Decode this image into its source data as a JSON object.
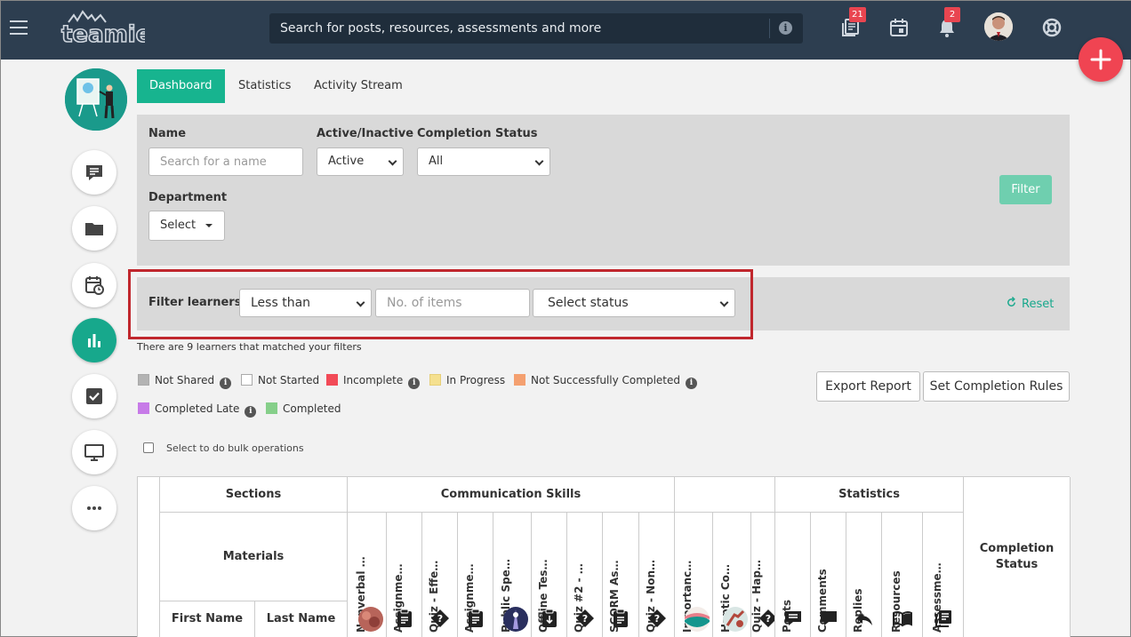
{
  "header": {
    "logo_text": "teamie",
    "search_placeholder": "Search for posts, resources, assessments and more",
    "posts_badge": "21",
    "notifications_badge": "2",
    "icons": [
      "menu-icon",
      "info-icon",
      "posts-feed-icon",
      "calendar-icon",
      "bell-icon",
      "avatar",
      "help-lifebuoy-icon",
      "plus-icon"
    ]
  },
  "tabs": [
    {
      "label": "Dashboard",
      "active": true
    },
    {
      "label": "Statistics",
      "active": false
    },
    {
      "label": "Activity Stream",
      "active": false
    }
  ],
  "filters": {
    "name_label": "Name",
    "name_placeholder": "Search for a name",
    "active_label": "Active/Inactive",
    "active_value": "Active",
    "completion_label": "Completion Status",
    "completion_value": "All",
    "department_label": "Department",
    "department_value": "Select",
    "filter_button": "Filter"
  },
  "learner_filter": {
    "label": "Filter learners",
    "comparison_value": "Less than",
    "items_placeholder": "No. of items",
    "status_value": "Select status",
    "reset_label": "Reset"
  },
  "matched_text": "There are 9 learners that matched your filters",
  "legend": [
    {
      "label": "Not Shared",
      "color": "#b3b3b3",
      "info": true
    },
    {
      "label": "Not Started",
      "color": "#ffffff",
      "info": false
    },
    {
      "label": "Incomplete",
      "color": "#f24a57",
      "info": true
    },
    {
      "label": "In Progress",
      "color": "#f5e08f",
      "info": false
    },
    {
      "label": "Not Successfully Completed",
      "color": "#f4a070",
      "info": true
    },
    {
      "label": "Completed Late",
      "color": "#c77be8",
      "info": true
    },
    {
      "label": "Completed",
      "color": "#86cf8a",
      "info": false
    }
  ],
  "actions": {
    "export": "Export Report",
    "completion_rules": "Set Completion Rules"
  },
  "bulk_label": "Select to do bulk operations",
  "table": {
    "sections_header": "Sections",
    "materials_header": "Materials",
    "first_name": "First Name",
    "last_name": "Last Name",
    "group_communication": "Communication Skills",
    "group_statistics": "Statistics",
    "completion_status": "Completion Status",
    "materials": [
      {
        "label": "Nonverbal Co...",
        "icon": "thumbnail-image"
      },
      {
        "label": "Assignment #...",
        "icon": "assignment-clipboard-icon"
      },
      {
        "label": "Quiz - Effectiv...",
        "icon": "quiz-question-icon"
      },
      {
        "label": "Assignment #...",
        "icon": "assignment-clipboard-icon"
      },
      {
        "label": "Public Speaki...",
        "icon": "thumbnail-image"
      },
      {
        "label": "Offline Test - ...",
        "icon": "offline-test-icon"
      },
      {
        "label": "Quiz #2 - Non...",
        "icon": "quiz-question-icon"
      },
      {
        "label": "SCORM Assig...",
        "icon": "assignment-clipboard-icon"
      },
      {
        "label": "Quiz - Non-ve...",
        "icon": "quiz-question-icon"
      },
      {
        "label": "Importance o...",
        "icon": "thumbnail-image"
      },
      {
        "label": "Haptic Comm...",
        "icon": "thumbnail-image"
      },
      {
        "label": "Quiz - Haptic",
        "icon": "quiz-question-icon"
      }
    ],
    "stats": [
      {
        "label": "Posts",
        "icon": "posts-icon"
      },
      {
        "label": "Comments",
        "icon": "comments-icon"
      },
      {
        "label": "Replies",
        "icon": "reply-icon"
      },
      {
        "label": "Resources",
        "icon": "book-icon"
      },
      {
        "label": "Assessments",
        "icon": "assessments-icon"
      }
    ]
  }
}
